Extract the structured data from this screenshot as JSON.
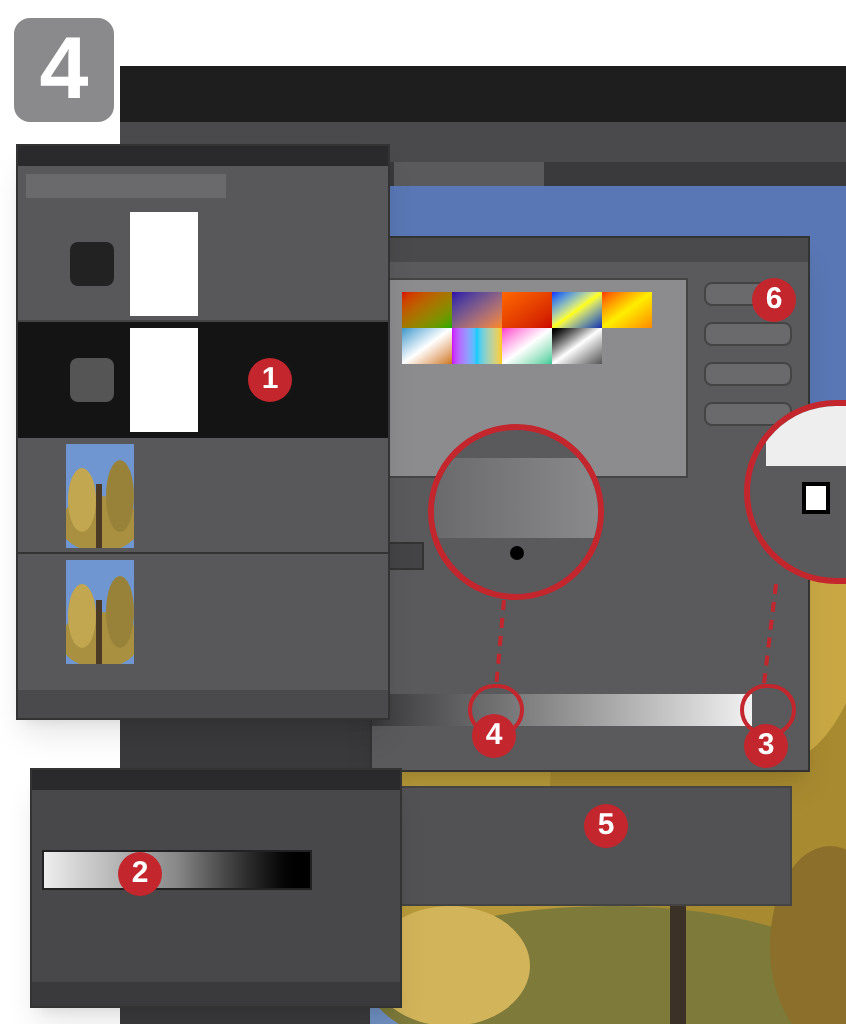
{
  "step": "4",
  "markers": [
    {
      "label": "1"
    },
    {
      "label": "2"
    },
    {
      "label": "3"
    },
    {
      "label": "4"
    },
    {
      "label": "5"
    },
    {
      "label": "6"
    }
  ]
}
